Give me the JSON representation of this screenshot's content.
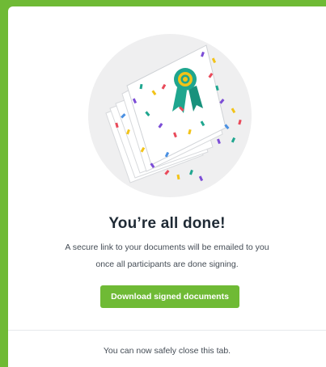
{
  "completion": {
    "title": "You’re all done!",
    "message_line1": "A secure link to your documents will be emailed to you",
    "message_line2": "once all participants are done signing.",
    "download_label": "Download signed documents",
    "footer_text": "You can now safely close this tab."
  },
  "colors": {
    "accent": "#6fba35",
    "circle": "#efeff0",
    "ribbon": "#1fa68f",
    "seal_center": "#f2c318"
  },
  "icons": {
    "illustration": "signed-documents-with-seal-and-confetti"
  }
}
